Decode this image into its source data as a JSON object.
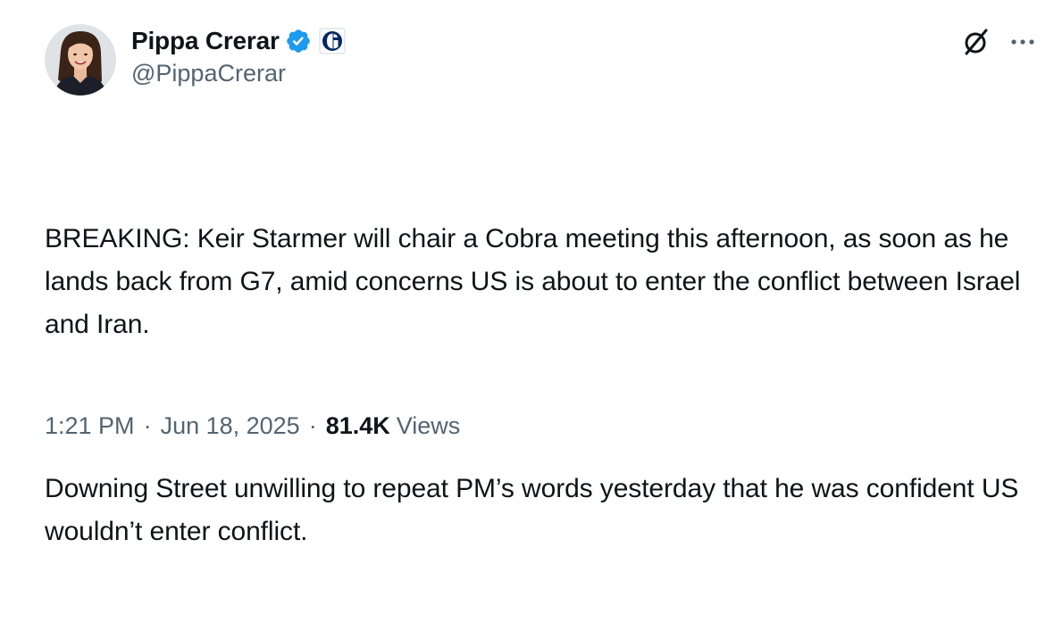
{
  "author": {
    "display_name": "Pippa Crerar",
    "handle": "@PippaCrerar",
    "verified": true,
    "verified_color": "#1d9bf0",
    "affiliation_icon": "guardian-logo-icon"
  },
  "tweet": {
    "paragraphs": [
      "BREAKING: Keir Starmer will chair a Cobra meeting this afternoon, as soon as he lands back from G7, amid concerns US is about to enter the conflict between Israel and Iran.",
      "Downing Street unwilling to repeat PM’s words yesterday that he was confident US wouldn’t enter conflict."
    ]
  },
  "meta": {
    "time": "1:21 PM",
    "separator": "·",
    "date": "Jun 18, 2025",
    "views_count": "81.4K",
    "views_label": "Views"
  },
  "actions": {
    "grok_icon": "grok-icon",
    "more_icon": "more-icon"
  },
  "colors": {
    "text_primary": "#0f1419",
    "text_secondary": "#536471",
    "accent": "#1d9bf0"
  }
}
